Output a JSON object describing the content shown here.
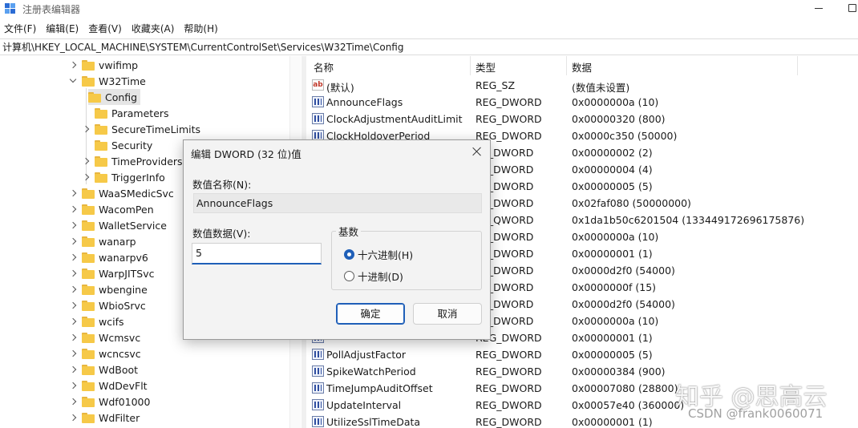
{
  "window": {
    "title": "注册表编辑器"
  },
  "menu": [
    "文件(F)",
    "编辑(E)",
    "查看(V)",
    "收藏夹(A)",
    "帮助(H)"
  ],
  "address": "计算机\\HKEY_LOCAL_MACHINE\\SYSTEM\\CurrentControlSet\\Services\\W32Time\\Config",
  "tree": [
    {
      "label": "vwifimp",
      "expander": "right",
      "level": 1
    },
    {
      "label": "W32Time",
      "expander": "down",
      "level": 1
    },
    {
      "label": "Config",
      "expander": "none",
      "level": 2,
      "selected": true
    },
    {
      "label": "Parameters",
      "expander": "none",
      "level": 2
    },
    {
      "label": "SecureTimeLimits",
      "expander": "right",
      "level": 2
    },
    {
      "label": "Security",
      "expander": "none",
      "level": 2
    },
    {
      "label": "TimeProviders",
      "expander": "right",
      "level": 2
    },
    {
      "label": "TriggerInfo",
      "expander": "right",
      "level": 2
    },
    {
      "label": "WaaSMedicSvc",
      "expander": "right",
      "level": 1
    },
    {
      "label": "WacomPen",
      "expander": "right",
      "level": 1
    },
    {
      "label": "WalletService",
      "expander": "right",
      "level": 1
    },
    {
      "label": "wanarp",
      "expander": "right",
      "level": 1
    },
    {
      "label": "wanarpv6",
      "expander": "right",
      "level": 1
    },
    {
      "label": "WarpJITSvc",
      "expander": "right",
      "level": 1
    },
    {
      "label": "wbengine",
      "expander": "right",
      "level": 1
    },
    {
      "label": "WbioSrvc",
      "expander": "right",
      "level": 1
    },
    {
      "label": "wcifs",
      "expander": "right",
      "level": 1
    },
    {
      "label": "Wcmsvc",
      "expander": "right",
      "level": 1
    },
    {
      "label": "wcncsvc",
      "expander": "right",
      "level": 1
    },
    {
      "label": "WdBoot",
      "expander": "right",
      "level": 1
    },
    {
      "label": "WdDevFlt",
      "expander": "right",
      "level": 1
    },
    {
      "label": "Wdf01000",
      "expander": "right",
      "level": 1
    },
    {
      "label": "WdFilter",
      "expander": "right",
      "level": 1
    }
  ],
  "list": {
    "headers": {
      "name": "名称",
      "type": "类型",
      "data": "数据"
    },
    "rows": [
      {
        "icon": "string",
        "name": "(默认)",
        "type": "REG_SZ",
        "data": "(数值未设置)"
      },
      {
        "icon": "binary",
        "name": "AnnounceFlags",
        "type": "REG_DWORD",
        "data": "0x0000000a (10)"
      },
      {
        "icon": "binary",
        "name": "ClockAdjustmentAuditLimit",
        "type": "REG_DWORD",
        "data": "0x00000320 (800)"
      },
      {
        "icon": "binary",
        "name": "ClockHoldoverPeriod",
        "type": "REG_DWORD",
        "data": "0x0000c350 (50000)"
      },
      {
        "icon": "binary",
        "name": "",
        "type": "_G_DWORD",
        "data": "0x00000002 (2)"
      },
      {
        "icon": "binary",
        "name": "",
        "type": "_G_DWORD",
        "data": "0x00000004 (4)"
      },
      {
        "icon": "binary",
        "name": "",
        "type": "_G_DWORD",
        "data": "0x00000005 (5)"
      },
      {
        "icon": "binary",
        "name": "",
        "type": "_G_DWORD",
        "data": "0x02faf080 (50000000)"
      },
      {
        "icon": "binary",
        "name": "",
        "type": "_G_QWORD",
        "data": "0x1da1b50c6201504 (133449172696175876)"
      },
      {
        "icon": "binary",
        "name": "",
        "type": "_G_DWORD",
        "data": "0x0000000a (10)"
      },
      {
        "icon": "binary",
        "name": "",
        "type": "_G_DWORD",
        "data": "0x00000001 (1)"
      },
      {
        "icon": "binary",
        "name": "",
        "type": "_G_DWORD",
        "data": "0x0000d2f0 (54000)"
      },
      {
        "icon": "binary",
        "name": "",
        "type": "_G_DWORD",
        "data": "0x0000000f (15)"
      },
      {
        "icon": "binary",
        "name": "",
        "type": "_G_DWORD",
        "data": "0x0000d2f0 (54000)"
      },
      {
        "icon": "binary",
        "name": "",
        "type": "_G_DWORD",
        "data": "0x0000000a (10)"
      },
      {
        "icon": "binary",
        "name": "",
        "type": "REG_DWORD",
        "data": "0x00000001 (1)"
      },
      {
        "icon": "binary",
        "name": "PollAdjustFactor",
        "type": "REG_DWORD",
        "data": "0x00000005 (5)"
      },
      {
        "icon": "binary",
        "name": "SpikeWatchPeriod",
        "type": "REG_DWORD",
        "data": "0x00000384 (900)"
      },
      {
        "icon": "binary",
        "name": "TimeJumpAuditOffset",
        "type": "REG_DWORD",
        "data": "0x00007080 (28800)"
      },
      {
        "icon": "binary",
        "name": "UpdateInterval",
        "type": "REG_DWORD",
        "data": "0x00057e40 (360000)"
      },
      {
        "icon": "binary",
        "name": "UtilizeSslTimeData",
        "type": "REG_DWORD",
        "data": "0x00000001 (1)"
      }
    ]
  },
  "dialog": {
    "title": "编辑 DWORD (32 位)值",
    "name_label": "数值名称(N):",
    "name_value": "AnnounceFlags",
    "data_label": "数值数据(V):",
    "data_value": "5",
    "base_label": "基数",
    "radio_hex": "十六进制(H)",
    "radio_dec": "十进制(D)",
    "selected_base": "hex",
    "ok": "确定",
    "cancel": "取消"
  },
  "watermarks": {
    "zhihu": "知乎 @思高云",
    "csdn": "CSDN @frank0060071"
  }
}
